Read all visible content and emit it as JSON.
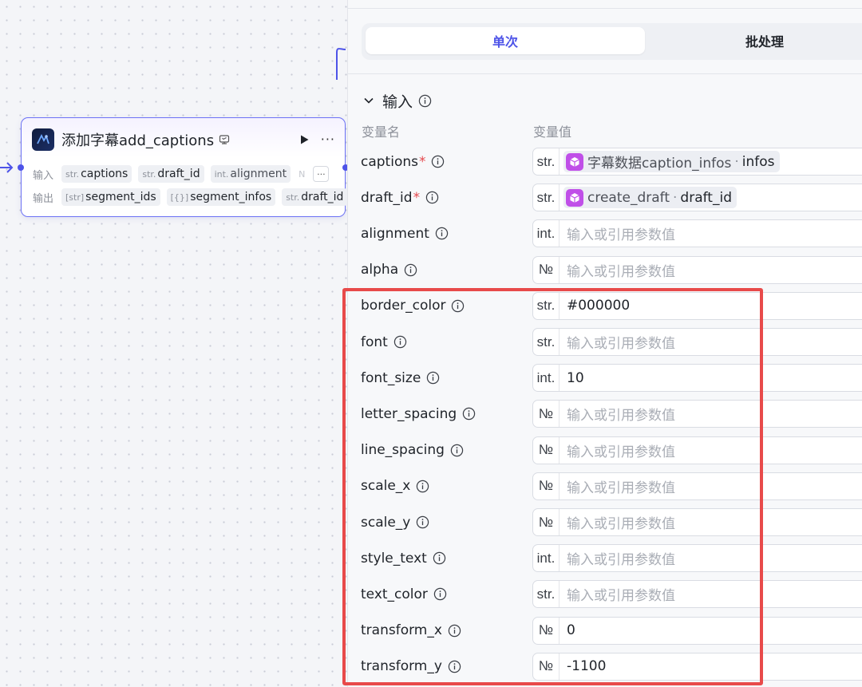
{
  "node": {
    "title": "添加字幕add_captions",
    "input_label": "输入",
    "output_label": "输出",
    "inputs": [
      {
        "type": "str.",
        "name": "captions"
      },
      {
        "type": "str.",
        "name": "draft_id"
      },
      {
        "type": "int.",
        "name": "alignment"
      },
      {
        "type": "N",
        "name": ""
      }
    ],
    "outputs": [
      {
        "type": "[str]",
        "name": "segment_ids"
      },
      {
        "type": "[{}]",
        "name": "segment_infos"
      },
      {
        "type": "str.",
        "name": "draft_id"
      }
    ],
    "more_chip": "···",
    "more_menu": "···"
  },
  "panel": {
    "tabs": [
      {
        "label": "单次",
        "active": true
      },
      {
        "label": "批处理",
        "active": false
      }
    ],
    "section_title": "输入",
    "col_name": "变量名",
    "col_value": "变量值",
    "placeholder": "输入或引用参数值",
    "params": [
      {
        "name": "captions",
        "required": "*",
        "type": "str.",
        "ref_source": "字幕数据caption_infos",
        "ref_dot": "·",
        "ref_key": "infos"
      },
      {
        "name": "draft_id",
        "required": "*",
        "type": "str.",
        "ref_source": "create_draft",
        "ref_dot": "·",
        "ref_key": "draft_id"
      },
      {
        "name": "alignment",
        "type": "int.",
        "value": ""
      },
      {
        "name": "alpha",
        "type": "№",
        "value": ""
      },
      {
        "name": "border_color",
        "type": "str.",
        "value": "#000000"
      },
      {
        "name": "font",
        "type": "str.",
        "value": ""
      },
      {
        "name": "font_size",
        "type": "int.",
        "value": "10"
      },
      {
        "name": "letter_spacing",
        "type": "№",
        "value": ""
      },
      {
        "name": "line_spacing",
        "type": "№",
        "value": ""
      },
      {
        "name": "scale_x",
        "type": "№",
        "value": ""
      },
      {
        "name": "scale_y",
        "type": "№",
        "value": ""
      },
      {
        "name": "style_text",
        "type": "int.",
        "value": ""
      },
      {
        "name": "text_color",
        "type": "str.",
        "value": ""
      },
      {
        "name": "transform_x",
        "type": "№",
        "value": "0"
      },
      {
        "name": "transform_y",
        "type": "№",
        "value": "-1100"
      }
    ]
  },
  "colors": {
    "accent": "#4d53e8",
    "highlight": "#e84a4a",
    "ref_icon": "#c04fe8",
    "required": "#e5484d"
  }
}
